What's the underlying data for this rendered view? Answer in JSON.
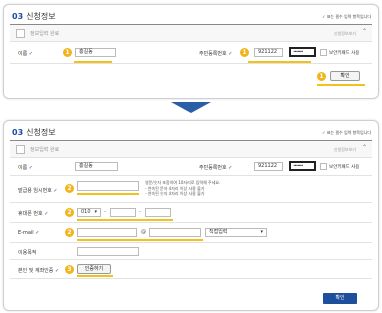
{
  "panel_top": {
    "number": "03",
    "title": "신청정보",
    "required_note": "표는 필수 입력 항목입니다",
    "checkbox_label": "정보입력 완료",
    "toggle_label": "신청정보보기",
    "name_label": "이름",
    "name_value": "홍길동",
    "rrn_label": "주민등록번호",
    "rrn_front": "921122",
    "rrn_back": "•••••••",
    "security_keypad_label": "보안키패드 사용",
    "confirm_label": "확인",
    "badges": [
      "1",
      "1",
      "1"
    ]
  },
  "panel_bottom": {
    "number": "03",
    "title": "신청정보",
    "required_note": "표는 필수 입력 항목입니다",
    "checkbox_label": "정보입력 완료",
    "toggle_label": "신청정보보기",
    "name_label": "이름",
    "name_value": "홍길동",
    "rrn_label": "주민등록번호",
    "rrn_front": "921122",
    "rrn_back": "•••••••",
    "security_keypad_label": "보안키패드 사용",
    "card_password_label": "발급용 임시번호",
    "card_password_notes": [
      "영문/숫자 포함하여 10자리로 입력해 주세요.",
      "- 연속된 문자 4자리 이상 사용 불가",
      "- 연속된 숫자 4자리 이상 사용 불가"
    ],
    "phone_label": "휴대폰 번호",
    "phone_prefix": "010",
    "email_label": "E-mail",
    "email_at": "@",
    "email_domain": "직접입력",
    "purpose_label": "이용목적",
    "auth_label": "본인 및 계좌인증",
    "auth_button": "인증하기",
    "confirm_label": "확인",
    "badges": [
      "2",
      "2",
      "2",
      "2",
      "3"
    ]
  },
  "colors": {
    "accent": "#1a4aa8",
    "badge": "#f2b418",
    "underline": "#f2c21a",
    "button": "#1e4f9c"
  }
}
